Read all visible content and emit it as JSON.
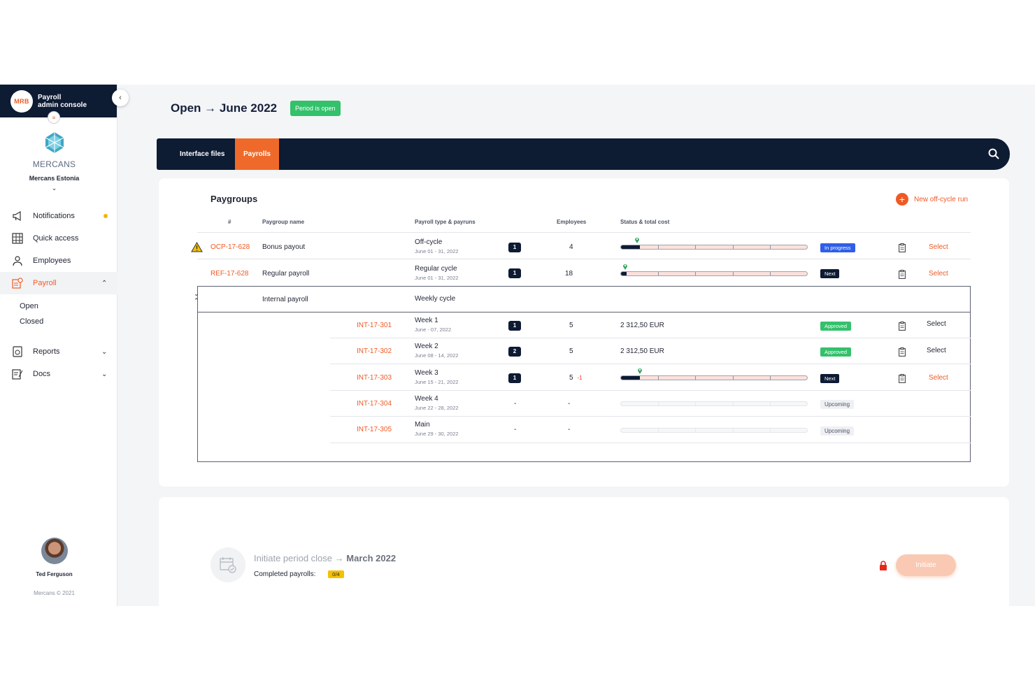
{
  "sidebar": {
    "logo_text": "MRB",
    "title_line1": "Payroll",
    "title_line2": "admin console",
    "company_word": "MERCANS",
    "entity": "Mercans Estonia",
    "nav": [
      {
        "label": "Notifications",
        "icon": "megaphone-icon"
      },
      {
        "label": "Quick access",
        "icon": "grid-icon"
      },
      {
        "label": "Employees",
        "icon": "employees-icon"
      },
      {
        "label": "Payroll",
        "icon": "payroll-icon",
        "active": true
      },
      {
        "label": "Reports",
        "icon": "reports-icon"
      },
      {
        "label": "Docs",
        "icon": "docs-icon"
      }
    ],
    "payroll_sub": [
      "Open",
      "Closed"
    ],
    "user_name": "Ted Ferguson",
    "copyright": "Mercans © 2021"
  },
  "header": {
    "title": "Open → June 2022",
    "status_pill": "Period is open"
  },
  "tabs": [
    "Interface files",
    "Payrolls"
  ],
  "paygroups": {
    "title": "Paygroups",
    "new_run_label": "New off-cycle run",
    "columns": [
      "#",
      "Paygroup name",
      "Payroll type & payruns",
      "Employees",
      "Status & total cost"
    ],
    "rows": [
      {
        "code": "OCP-17-628",
        "name": "Bonus payout",
        "type": "Off-cycle",
        "dates": "June 01 - 31, 2022",
        "runs": "1",
        "employees": "4",
        "progress": 0.1,
        "badge": "In progress",
        "select": "Select"
      },
      {
        "code": "REF-17-628",
        "name": "Regular payroll",
        "type": "Regular cycle",
        "dates": "June 01 - 31, 2022",
        "runs": "1",
        "employees": "18",
        "progress": 0.03,
        "badge": "Next",
        "select": "Select"
      }
    ],
    "group": {
      "name": "Internal payroll",
      "type": "Weekly cycle",
      "subrows": [
        {
          "code": "INT-17-301",
          "type": "Week 1",
          "dates": "June - 07, 2022",
          "runs": "1",
          "employees": "5",
          "cost": "2 312,50 EUR",
          "badge": "Approved",
          "select": "Select"
        },
        {
          "code": "INT-17-302",
          "type": "Week 2",
          "dates": "June 08 - 14, 2022",
          "runs": "2",
          "employees": "5",
          "cost": "2 312,50 EUR",
          "badge": "Approved",
          "select": "Select"
        },
        {
          "code": "INT-17-303",
          "type": "Week 3",
          "dates": "June 15 - 21, 2022",
          "runs": "1",
          "employees": "5",
          "delta": "-1",
          "progress": 0.1,
          "badge": "Next",
          "select": "Select"
        },
        {
          "code": "INT-17-304",
          "type": "Week 4",
          "dates": "June 22 - 28, 2022",
          "runs": "-",
          "employees": "-",
          "badge": "Upcoming"
        },
        {
          "code": "INT-17-305",
          "type": "Main",
          "dates": "June 29 - 30, 2022",
          "runs": "-",
          "employees": "-",
          "badge": "Upcoming"
        }
      ]
    }
  },
  "period_close": {
    "label": "Initiate period close",
    "arrow": "→",
    "month": "March 2022",
    "completed_label": "Completed payrolls:",
    "completed_count": "0/4",
    "button": "Initiate"
  },
  "colors": {
    "navy": "#0d1b33",
    "accent": "#ef5a24",
    "green": "#33c16b",
    "blue": "#2f5ee8",
    "yellow": "#f5c000"
  }
}
